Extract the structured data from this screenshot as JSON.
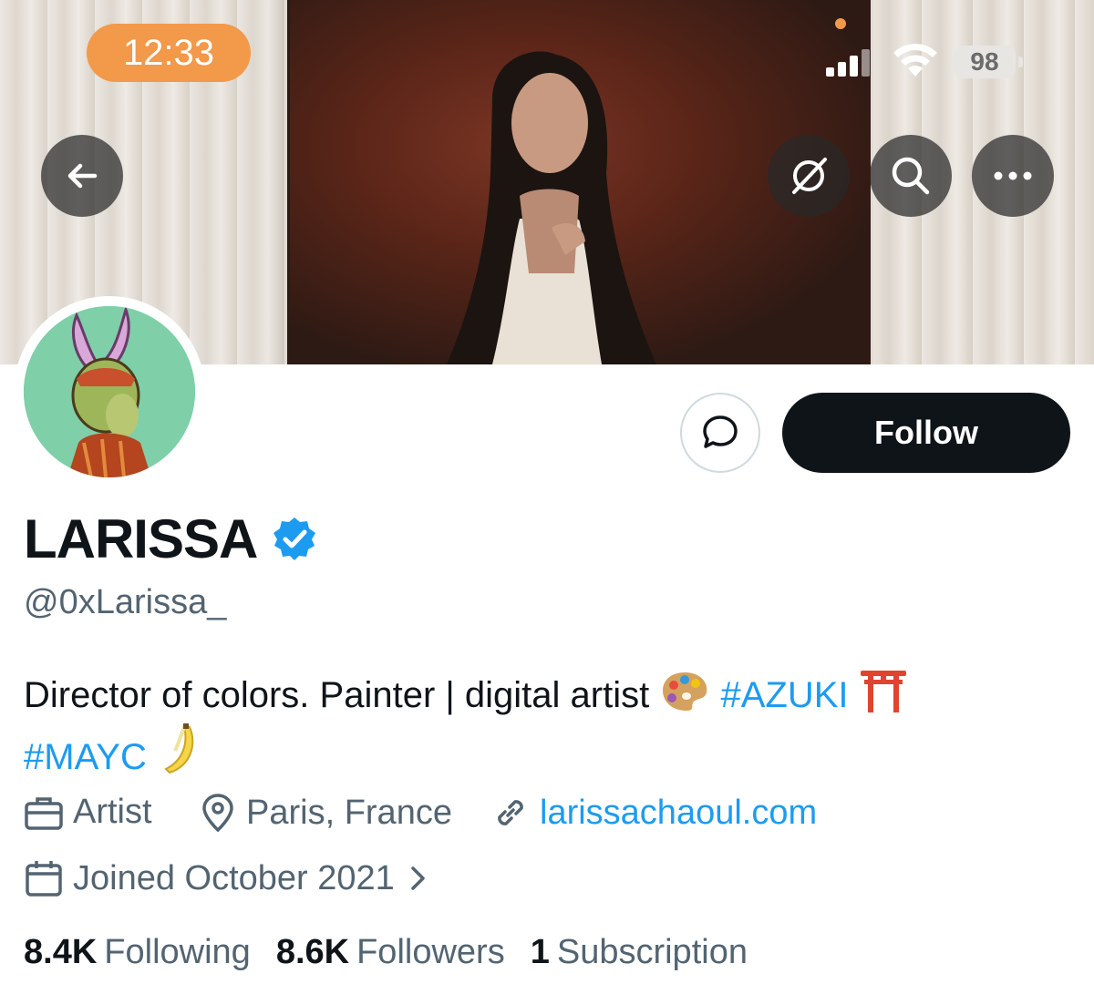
{
  "status_bar": {
    "time": "12:33",
    "battery": "98"
  },
  "profile": {
    "name": "LARISSA",
    "handle": "@0xLarissa_",
    "bio": {
      "text": "Director of colors. Painter | digital artist",
      "tag1": "#AZUKI",
      "tag2": "#MAYC"
    },
    "profession": "Artist",
    "location": "Paris, France",
    "website": "larissachaoul.com",
    "joined": "Joined October 2021"
  },
  "actions": {
    "follow_label": "Follow"
  },
  "stats": {
    "following_count": "8.4K",
    "following_label": "Following",
    "followers_count": "8.6K",
    "followers_label": "Followers",
    "subscriptions_count": "1",
    "subscriptions_label": "Subscription"
  },
  "colors": {
    "accent": "#1d9bf0",
    "follow_button": "#0f1419",
    "status_pill": "#f2994a",
    "verified": "#1d9bf0"
  }
}
